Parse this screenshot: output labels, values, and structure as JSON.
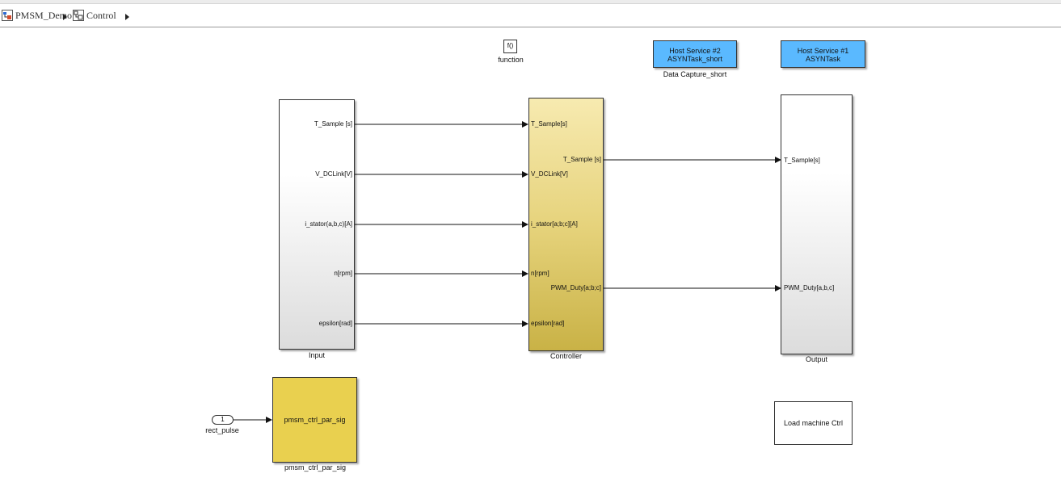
{
  "breadcrumb": {
    "items": [
      {
        "label": "PMSM_Demo",
        "icon": "model-icon"
      },
      {
        "label": "Control",
        "icon": "subsystem-icon"
      }
    ]
  },
  "blocks": {
    "function_block": {
      "glyph": "f()",
      "label": "function"
    },
    "host2": {
      "line1": "Host Service #2",
      "line2": "ASYNTask_short",
      "label": "Data Capture_short",
      "color": "#5ab9ff"
    },
    "host1": {
      "line1": "Host Service #1",
      "line2": "ASYNTask",
      "color": "#5ab9ff"
    },
    "input": {
      "label": "Input",
      "ports": [
        "T_Sample [s]",
        "V_DCLink[V]",
        "i_stator(a,b,c)[A]",
        "n[rpm]",
        "epsilon[rad]"
      ]
    },
    "controller": {
      "label": "Controller",
      "in_ports": [
        "T_Sample[s]",
        "V_DCLink[V]",
        "i_stator[a;b;c][A]",
        "n[rpm]",
        "epsilon[rad]"
      ],
      "out_ports": [
        "T_Sample [s]",
        "PWM_Duty[a;b;c]"
      ],
      "color_top": "#f7eab0",
      "color_bottom": "#c9b246"
    },
    "output": {
      "label": "Output",
      "ports": [
        "T_Sample[s]",
        "PWM_Duty[a,b,c]"
      ]
    },
    "pmsm": {
      "text": "pmsm_ctrl_par_sig",
      "label": "pmsm_ctrl_par_sig",
      "color": "#e9d04f"
    },
    "inport": {
      "number": "1",
      "label": "rect_pulse"
    },
    "load_ctrl": {
      "text": "Load machine Ctrl"
    }
  }
}
